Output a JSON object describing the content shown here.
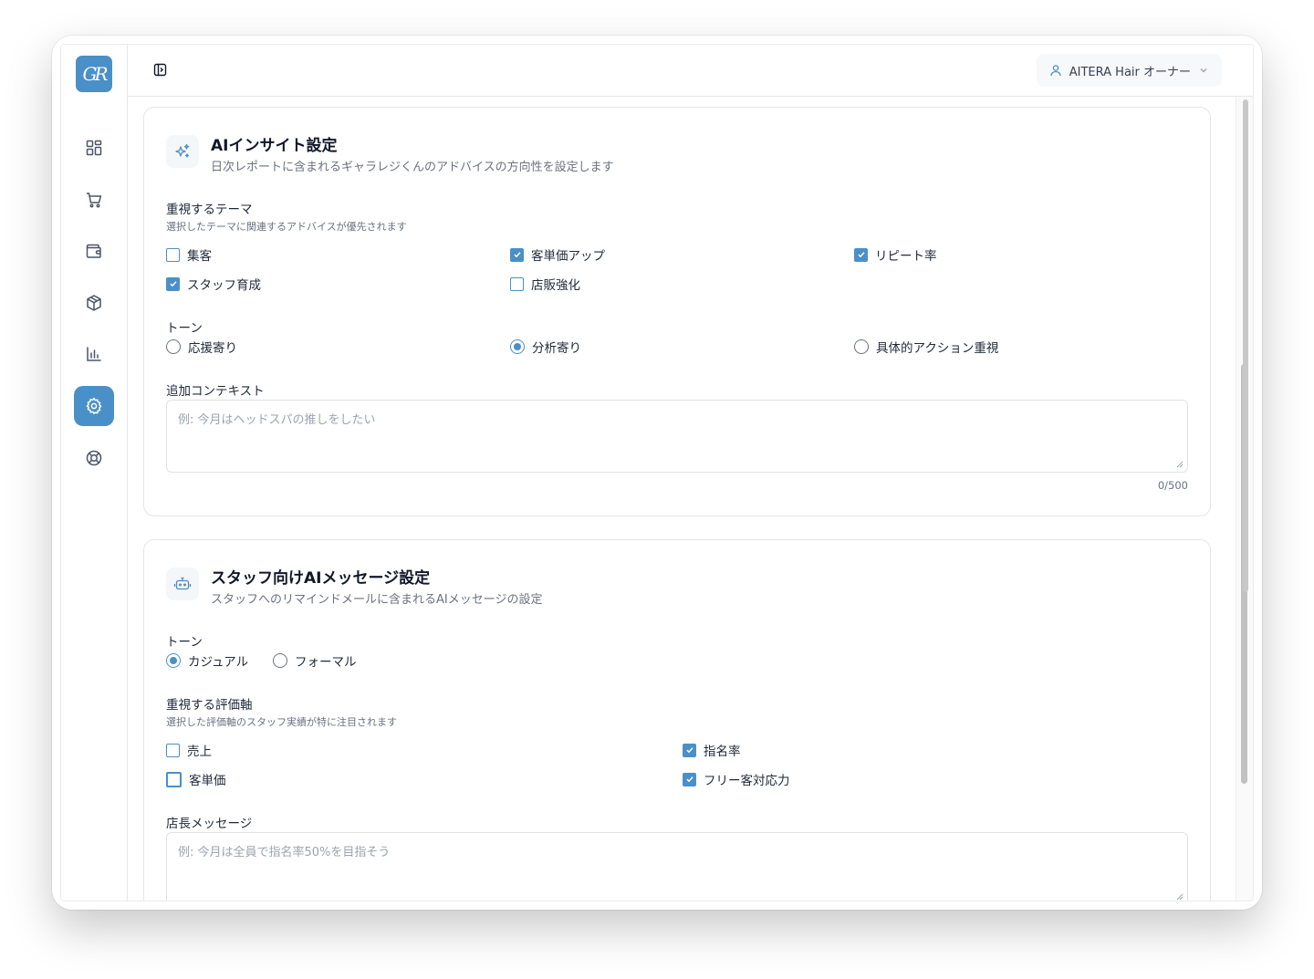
{
  "app": {
    "logo_text": "GR",
    "accent": "#4a90c8"
  },
  "sidebar": {
    "items": [
      {
        "icon": "dashboard-icon",
        "active": false
      },
      {
        "icon": "cart-icon",
        "active": false
      },
      {
        "icon": "wallet-icon",
        "active": false
      },
      {
        "icon": "box-icon",
        "active": false
      },
      {
        "icon": "bar-chart-icon",
        "active": false
      },
      {
        "icon": "gear-icon",
        "active": true
      },
      {
        "icon": "lifebuoy-icon",
        "active": false
      }
    ]
  },
  "header": {
    "user_label": "AITERA Hair オーナー"
  },
  "insight": {
    "title": "AIインサイト設定",
    "subtitle": "日次レポートに含まれるギャラレジくんのアドバイスの方向性を設定します",
    "themes_label": "重視するテーマ",
    "themes_hint": "選択したテーマに関連するアドバイスが優先されます",
    "themes": [
      {
        "label": "集客",
        "checked": false
      },
      {
        "label": "客単価アップ",
        "checked": true
      },
      {
        "label": "リピート率",
        "checked": true
      },
      {
        "label": "スタッフ育成",
        "checked": true
      },
      {
        "label": "店販強化",
        "checked": false
      }
    ],
    "tone_label": "トーン",
    "tones": [
      {
        "label": "応援寄り",
        "checked": false
      },
      {
        "label": "分析寄り",
        "checked": true
      },
      {
        "label": "具体的アクション重視",
        "checked": false
      }
    ],
    "context_label": "追加コンテキスト",
    "context_placeholder": "例: 今月はヘッドスパの推しをしたい",
    "context_counter": "0/500"
  },
  "staff": {
    "title": "スタッフ向けAIメッセージ設定",
    "subtitle": "スタッフへのリマインドメールに含まれるAIメッセージの設定",
    "tone_label": "トーン",
    "tones": [
      {
        "label": "カジュアル",
        "checked": true
      },
      {
        "label": "フォーマル",
        "checked": false
      }
    ],
    "axes_label": "重視する評価軸",
    "axes_hint": "選択した評価軸のスタッフ実績が特に注目されます",
    "axes": [
      {
        "label": "売上",
        "checked": false
      },
      {
        "label": "指名率",
        "checked": true
      },
      {
        "label": "客単価",
        "checked": false
      },
      {
        "label": "フリー客対応力",
        "checked": true
      }
    ],
    "message_label": "店長メッセージ",
    "message_placeholder": "例: 今月は全員で指名率50%を目指そう"
  }
}
